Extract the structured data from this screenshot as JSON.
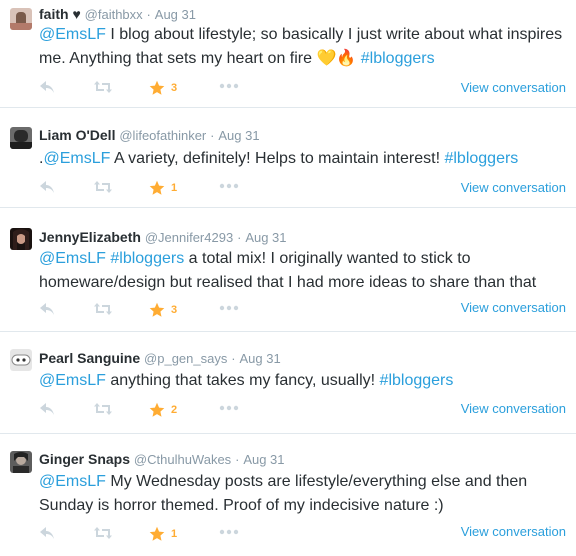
{
  "tweets": [
    {
      "name": "faith ♥",
      "handle": "@faithbxx",
      "sep": "·",
      "time": "Aug 31",
      "parts": [
        {
          "t": "@EmsLF",
          "link": true
        },
        {
          "t": " I blog about lifestyle; so basically I just write about what inspires me. Anything that sets my heart on fire 💛🔥 ",
          "link": false
        },
        {
          "t": "#lbloggers",
          "link": true
        }
      ],
      "fav_count": "3",
      "view": "View conversation",
      "avatar_color": "#7a5a4a"
    },
    {
      "name": "Liam O'Dell",
      "handle": "@lifeofathinker",
      "sep": "·",
      "time": "Aug 31",
      "parts": [
        {
          "t": ".",
          "link": false
        },
        {
          "t": "@EmsLF",
          "link": true
        },
        {
          "t": " A variety, definitely! Helps to maintain interest! ",
          "link": false
        },
        {
          "t": "#lbloggers",
          "link": true
        }
      ],
      "fav_count": "1",
      "view": "View conversation",
      "avatar_color": "#3a3a3a"
    },
    {
      "name": "JennyElizabeth",
      "handle": "@Jennifer4293",
      "sep": "·",
      "time": "Aug 31",
      "parts": [
        {
          "t": "@EmsLF",
          "link": true
        },
        {
          "t": " ",
          "link": false
        },
        {
          "t": "#lbloggers",
          "link": true
        },
        {
          "t": " a total mix! I originally wanted to stick to homeware/design but realised that I had more ideas to share than that",
          "link": false
        }
      ],
      "fav_count": "3",
      "view": "View conversation",
      "avatar_color": "#2e1d1a"
    },
    {
      "name": "Pearl Sanguine",
      "handle": "@p_gen_says",
      "sep": "·",
      "time": "Aug 31",
      "parts": [
        {
          "t": "@EmsLF",
          "link": true
        },
        {
          "t": " anything that takes my fancy, usually! ",
          "link": false
        },
        {
          "t": "#lbloggers",
          "link": true
        }
      ],
      "fav_count": "2",
      "view": "View conversation",
      "avatar_color": "#9a9a9a"
    },
    {
      "name": "Ginger Snaps",
      "handle": "@CthulhuWakes",
      "sep": "·",
      "time": "Aug 31",
      "parts": [
        {
          "t": "@EmsLF",
          "link": true
        },
        {
          "t": " My Wednesday posts are lifestyle/everything else and then Sunday is horror themed. Proof of my indecisive nature :)",
          "link": false
        }
      ],
      "fav_count": "1",
      "view": "View conversation",
      "avatar_color": "#4a4a4a"
    }
  ],
  "colors": {
    "link": "#2b9fdc",
    "muted": "#8899a6",
    "icon": "#ccd6dd",
    "favorite": "#ffac33"
  },
  "icons": {
    "reply": "reply-icon",
    "retweet": "retweet-icon",
    "favorite": "star-icon",
    "more": "more-icon"
  }
}
